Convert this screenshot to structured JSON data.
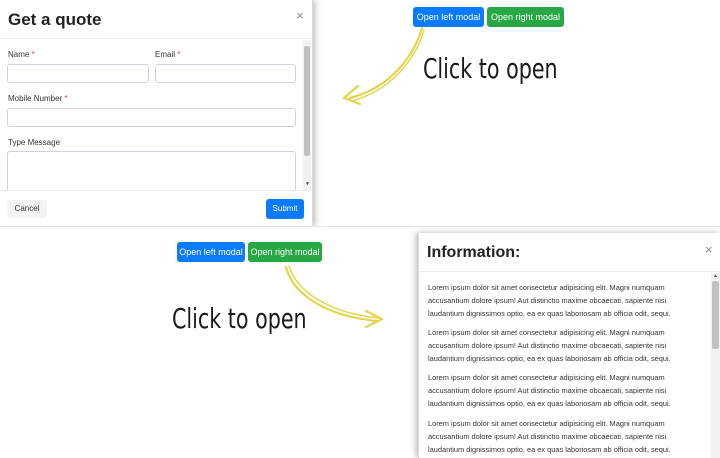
{
  "top_panel": {
    "buttons": {
      "open_left": "Open left modal",
      "open_right": "Open right modal"
    },
    "hint": "Click to open",
    "quote_modal": {
      "title": "Get a quote",
      "close_icon": "×",
      "name_label": "Name",
      "email_label": "Email",
      "mobile_label": "Mobile Number",
      "message_label": "Type Message",
      "required_mark": "*",
      "cancel": "Cancel",
      "submit": "Submit"
    }
  },
  "bottom_panel": {
    "buttons": {
      "open_left": "Open left modal",
      "open_right": "Open right modal"
    },
    "hint": "Click to open",
    "info_modal": {
      "title": "Information:",
      "close_icon": "×",
      "paragraphs": [
        {
          "line1": "Lorem ipsum dolor sit amet consectetur adipisicing elit. Magni numquam",
          "line2": "accusantium dolore ipsum! Aut distinctio maxime obcaecati, sapiente nisi",
          "line3": "laudantium dignissimos optio, ea ex quas laboriosam ab officia odit, sequi."
        },
        {
          "line1": "Lorem ipsum dolor sit amet consectetur adipisicing elit. Magni numquam",
          "line2": "accusantium dolore ipsum! Aut distinctio maxime obcaecati, sapiente nisi",
          "line3": "laudantium dignissimos optio, ea ex quas laboriosam ab officia odit, sequi."
        },
        {
          "line1": "Lorem ipsum dolor sit amet consectetur adipisicing elit. Magni numquam",
          "line2": "accusantium dolore ipsum! Aut distinctio maxime obcaecati, sapiente nisi",
          "line3": "laudantium dignissimos optio, ea ex quas laboriosam ab officia odit, sequi."
        },
        {
          "line1": "Lorem ipsum dolor sit amet consectetur adipisicing elit. Magni numquam",
          "line2": "accusantium dolore ipsum! Aut distinctio maxime obcaecati, sapiente nisi",
          "line3": "laudantium dignissimos optio, ea ex quas laboriosam ab officia odit, sequi."
        }
      ]
    }
  },
  "colors": {
    "primary": "#0a7bff",
    "success": "#28a745",
    "required": "#dc3545",
    "arrow": "#e3d44a"
  },
  "icons": {
    "close": "close-icon",
    "arrow": "curved-arrow-icon"
  }
}
